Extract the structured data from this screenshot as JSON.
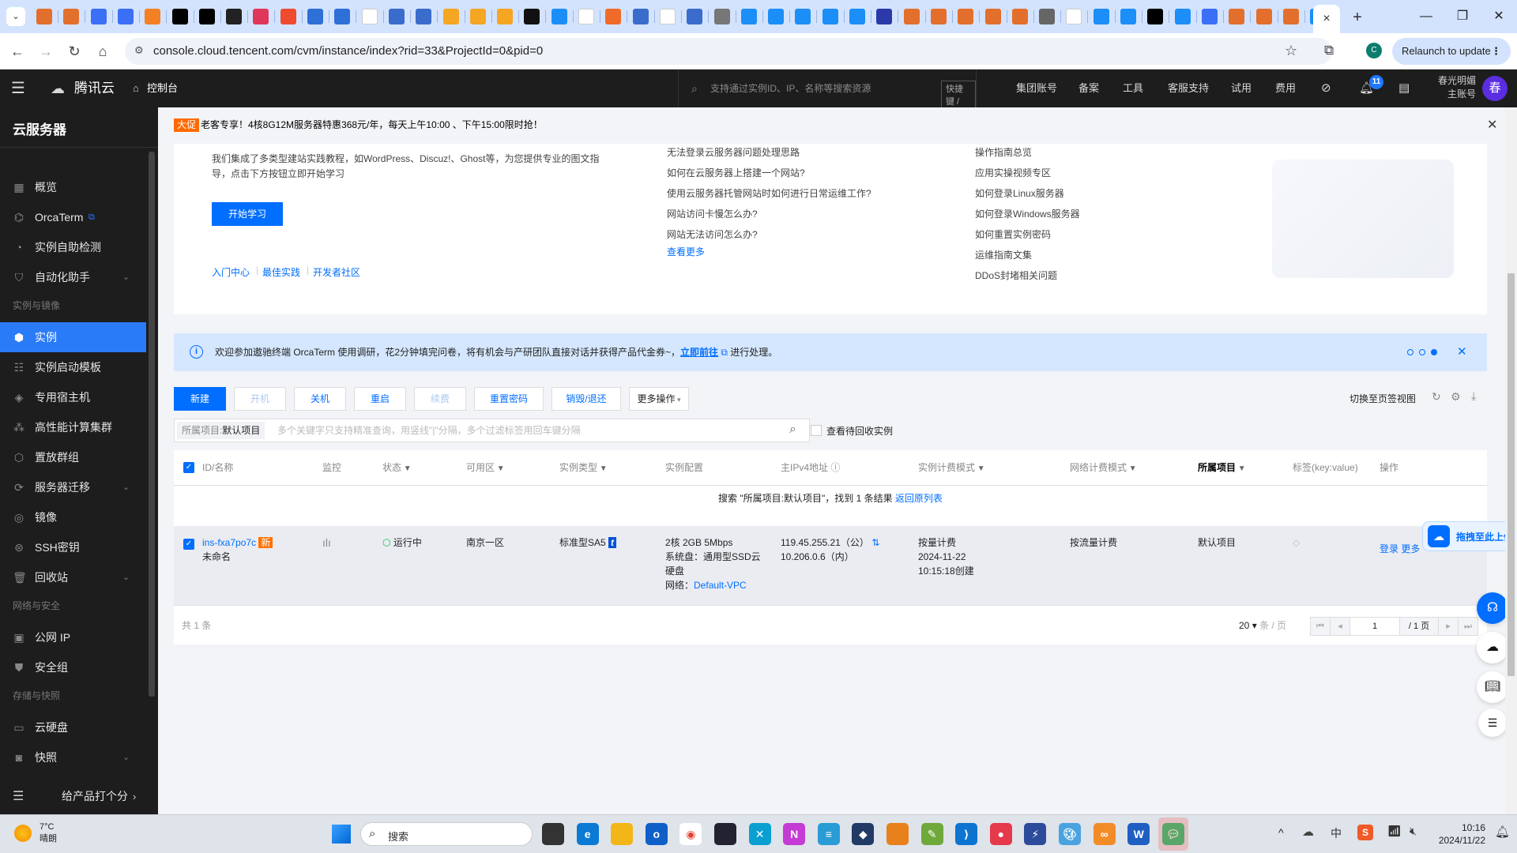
{
  "browser": {
    "url": "console.cloud.tencent.com/cvm/instance/index?rid=33&ProjectId=0&pid=0",
    "relaunch_label": "Relaunch to update",
    "profile_initial": "C",
    "active_tab_close": "×",
    "new_tab": "+",
    "window_controls": {
      "minimize": "—",
      "restore": "❐",
      "close": "✕"
    }
  },
  "topnav": {
    "brand": "腾讯云",
    "console": "控制台",
    "search_placeholder": "支持通过实例ID、IP、名称等搜索资源",
    "shortcut": "快捷键 /",
    "items": [
      "集团账号",
      "备案",
      "工具",
      "客服支持",
      "试用",
      "费用"
    ],
    "notification_count": "11",
    "account_name": "春光明媚",
    "account_type": "主账号",
    "avatar_text": "春"
  },
  "sidebar": {
    "title": "云服务器",
    "groups": [
      {
        "label": "",
        "items": [
          {
            "label": "概览",
            "icon": "grid-icon"
          },
          {
            "label": "OrcaTerm",
            "icon": "terminal-icon",
            "external": true
          },
          {
            "label": "实例自助检测",
            "icon": "check-icon"
          },
          {
            "label": "自动化助手",
            "icon": "automation-icon",
            "expandable": true
          }
        ]
      },
      {
        "label": "实例与镜像",
        "items": [
          {
            "label": "实例",
            "icon": "instance-icon",
            "active": true
          },
          {
            "label": "实例启动模板",
            "icon": "template-icon"
          },
          {
            "label": "专用宿主机",
            "icon": "host-icon"
          },
          {
            "label": "高性能计算集群",
            "icon": "cluster-icon"
          },
          {
            "label": "置放群组",
            "icon": "placement-icon"
          },
          {
            "label": "服务器迁移",
            "icon": "migrate-icon",
            "expandable": true
          },
          {
            "label": "镜像",
            "icon": "image-icon"
          },
          {
            "label": "SSH密钥",
            "icon": "key-icon"
          },
          {
            "label": "回收站",
            "icon": "trash-icon",
            "expandable": true
          }
        ]
      },
      {
        "label": "网络与安全",
        "items": [
          {
            "label": "公网 IP",
            "icon": "ip-icon"
          },
          {
            "label": "安全组",
            "icon": "shield-icon"
          }
        ]
      },
      {
        "label": "存储与快照",
        "items": [
          {
            "label": "云硬盘",
            "icon": "disk-icon"
          },
          {
            "label": "快照",
            "icon": "camera-icon",
            "expandable": true
          }
        ]
      }
    ],
    "footer_label": "给产品打个分"
  },
  "promo": {
    "tag": "大促",
    "text": "老客专享！4核8G12M服务器特惠368元/年，每天上午10:00 、下午15:00限时抢！"
  },
  "learn": {
    "description": "我们集成了多类型建站实践教程，如WordPress、Discuz!、Ghost等，为您提供专业的图文指导，点击下方按钮立即开始学习",
    "start_button": "开始学习",
    "bottom_links": [
      "入门中心",
      "最佳实践",
      "开发者社区"
    ],
    "faq_links": [
      "无法登录云服务器问题处理思路",
      "如何在云服务器上搭建一个网站?",
      "使用云服务器托管网站时如何进行日常运维工作?",
      "网站访问卡慢怎么办?",
      "网站无法访问怎么办?"
    ],
    "faq_more": "查看更多",
    "guide_links": [
      "操作指南总览",
      "应用实操视频专区",
      "如何登录Linux服务器",
      "如何登录Windows服务器",
      "如何重置实例密码",
      "运维指南文集",
      "DDoS封堵相关问题"
    ]
  },
  "notice": {
    "text": "欢迎参加遨驰终端 OrcaTerm 使用调研，花2分钟填完问卷，将有机会与产研团队直接对话并获得产品代金券~，",
    "link": "立即前往",
    "suffix": "进行处理。",
    "carousel_index": 3,
    "carousel_total": 3
  },
  "toolbar": {
    "buttons": [
      {
        "label": "新建",
        "state": "primary"
      },
      {
        "label": "开机",
        "state": "disabled"
      },
      {
        "label": "关机",
        "state": "normal"
      },
      {
        "label": "重启",
        "state": "normal"
      },
      {
        "label": "续费",
        "state": "disabled"
      },
      {
        "label": "重置密码",
        "state": "normal"
      },
      {
        "label": "销毁/退还",
        "state": "normal"
      },
      {
        "label": "更多操作",
        "state": "dropdown"
      }
    ],
    "switch_view": "切换至页签视图",
    "search_tag_key": "所属项目:",
    "search_tag_value": "默认项目",
    "search_placeholder": "多个关键字只支持精准查询，用竖线\"|\"分隔，多个过滤标签用回车键分隔",
    "recycle_checkbox": "查看待回收实例"
  },
  "table": {
    "columns": [
      "ID/名称",
      "监控",
      "状态",
      "可用区",
      "实例类型",
      "实例配置",
      "主IPv4地址",
      "实例计费模式",
      "网络计费模式",
      "所属项目",
      "标签(key:value)",
      "操作"
    ],
    "search_result": "搜索 \"所属项目:默认项目\"，找到 1 条结果",
    "back_link": "返回原列表",
    "rows": [
      {
        "id": "ins-fxa7po7c",
        "new_badge": "新",
        "name": "未命名",
        "status": "运行中",
        "zone": "南京一区",
        "type": "标准型SA5",
        "config_line1": "2核 2GB 5Mbps",
        "config_line2": "系统盘：通用型SSD云硬盘",
        "network_label": "网络：",
        "network": "Default-VPC",
        "public_ip": "119.45.255.21（公）",
        "private_ip": "10.206.0.6（内）",
        "billing": "按量计费",
        "created_date": "2024-11-22",
        "created_time": "10:15:18创建",
        "net_billing": "按流量计费",
        "project": "默认项目",
        "action_login": "登录",
        "action_more": "更多"
      }
    ],
    "total": "共 1 条",
    "page_size": "20",
    "page_size_unit": "条 / 页",
    "current_page": "1",
    "total_pages": "/ 1 页"
  },
  "floating": {
    "upload_hint": "拖拽至此上传"
  },
  "taskbar": {
    "weather_temp": "7°C",
    "weather_desc": "晴朗",
    "search_label": "搜索",
    "time": "10:16",
    "date": "2024/11/22",
    "ime": "中"
  }
}
